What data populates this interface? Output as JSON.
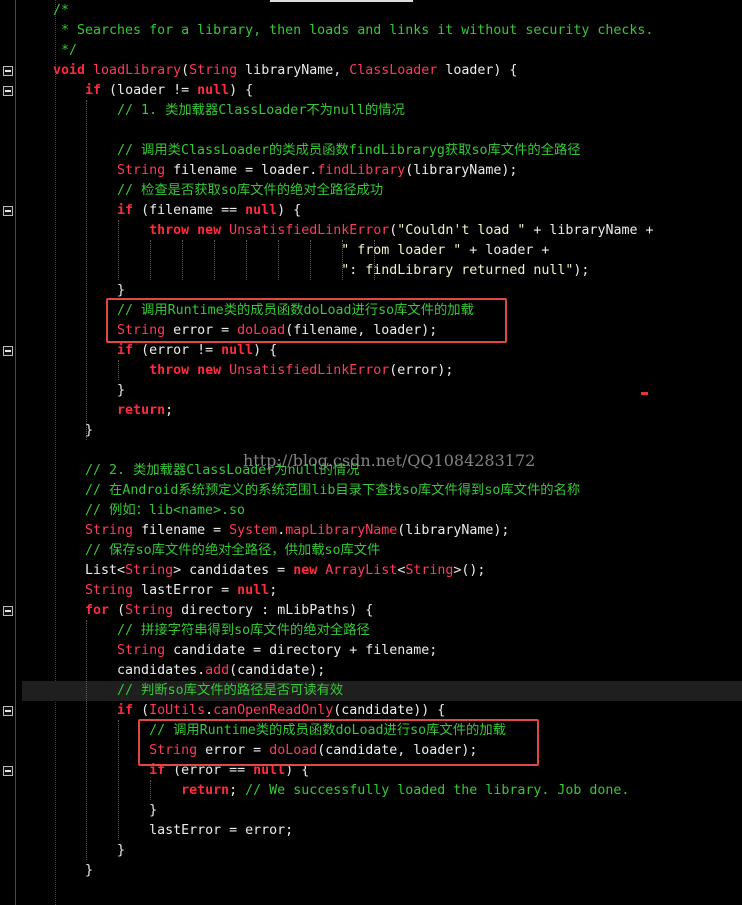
{
  "editor": {
    "lines": [
      [
        {
          "t": "/*",
          "c": "com"
        }
      ],
      [
        {
          "t": " * Searches for a library, then loads and links it without security checks.",
          "c": "com"
        }
      ],
      [
        {
          "t": " */",
          "c": "com"
        }
      ],
      [
        {
          "t": "void",
          "c": "kw"
        },
        {
          "t": " ",
          "c": "plain"
        },
        {
          "t": "loadLibrary",
          "c": "fn"
        },
        {
          "t": "(",
          "c": "plain"
        },
        {
          "t": "String",
          "c": "ty"
        },
        {
          "t": " libraryName, ",
          "c": "plain"
        },
        {
          "t": "ClassLoader",
          "c": "ty"
        },
        {
          "t": " loader) {",
          "c": "plain"
        }
      ],
      [
        {
          "t": "    ",
          "c": "plain"
        },
        {
          "t": "if",
          "c": "kw"
        },
        {
          "t": " (loader != ",
          "c": "plain"
        },
        {
          "t": "null",
          "c": "kw"
        },
        {
          "t": ") {",
          "c": "plain"
        }
      ],
      [
        {
          "t": "        // 1. 类加载器ClassLoader不为null的情况",
          "c": "com"
        }
      ],
      [],
      [
        {
          "t": "        // 调用类ClassLoader的类成员函数findLibraryg获取so库文件的全路径",
          "c": "com"
        }
      ],
      [
        {
          "t": "        ",
          "c": "plain"
        },
        {
          "t": "String",
          "c": "ty"
        },
        {
          "t": " filename = loader.",
          "c": "plain"
        },
        {
          "t": "findLibrary",
          "c": "fn"
        },
        {
          "t": "(libraryName);",
          "c": "plain"
        }
      ],
      [
        {
          "t": "        // 检查是否获取so库文件的绝对全路径成功",
          "c": "com"
        }
      ],
      [
        {
          "t": "        ",
          "c": "plain"
        },
        {
          "t": "if",
          "c": "kw"
        },
        {
          "t": " (filename == ",
          "c": "plain"
        },
        {
          "t": "null",
          "c": "kw"
        },
        {
          "t": ") {",
          "c": "plain"
        }
      ],
      [
        {
          "t": "            ",
          "c": "plain"
        },
        {
          "t": "throw",
          "c": "kw"
        },
        {
          "t": " ",
          "c": "plain"
        },
        {
          "t": "new",
          "c": "kw"
        },
        {
          "t": " ",
          "c": "plain"
        },
        {
          "t": "UnsatisfiedLinkError",
          "c": "ty"
        },
        {
          "t": "(",
          "c": "plain"
        },
        {
          "t": "\"Couldn't load \"",
          "c": "str"
        },
        {
          "t": " + libraryName +",
          "c": "plain"
        }
      ],
      [
        {
          "t": "                                    ",
          "c": "plain"
        },
        {
          "t": "\" from loader \"",
          "c": "str"
        },
        {
          "t": " + loader +",
          "c": "plain"
        }
      ],
      [
        {
          "t": "                                    ",
          "c": "plain"
        },
        {
          "t": "\": findLibrary returned null\"",
          "c": "str"
        },
        {
          "t": ");",
          "c": "plain"
        }
      ],
      [
        {
          "t": "        }",
          "c": "plain"
        }
      ],
      [
        {
          "t": "        // 调用Runtime类的成员函数doLoad进行so库文件的加载",
          "c": "com"
        }
      ],
      [
        {
          "t": "        ",
          "c": "plain"
        },
        {
          "t": "String",
          "c": "ty"
        },
        {
          "t": " error = ",
          "c": "plain"
        },
        {
          "t": "doLoad",
          "c": "fn"
        },
        {
          "t": "(filename, loader);",
          "c": "plain"
        }
      ],
      [
        {
          "t": "        ",
          "c": "plain"
        },
        {
          "t": "if",
          "c": "kw"
        },
        {
          "t": " (error != ",
          "c": "plain"
        },
        {
          "t": "null",
          "c": "kw"
        },
        {
          "t": ") {",
          "c": "plain"
        }
      ],
      [
        {
          "t": "            ",
          "c": "plain"
        },
        {
          "t": "throw",
          "c": "kw"
        },
        {
          "t": " ",
          "c": "plain"
        },
        {
          "t": "new",
          "c": "kw"
        },
        {
          "t": " ",
          "c": "plain"
        },
        {
          "t": "UnsatisfiedLinkError",
          "c": "ty"
        },
        {
          "t": "(error);",
          "c": "plain"
        }
      ],
      [
        {
          "t": "        }",
          "c": "plain"
        }
      ],
      [
        {
          "t": "        ",
          "c": "plain"
        },
        {
          "t": "return",
          "c": "kw"
        },
        {
          "t": ";",
          "c": "plain"
        }
      ],
      [
        {
          "t": "    }",
          "c": "plain"
        }
      ],
      [],
      [
        {
          "t": "    // 2. 类加载器ClassLoader为null的情况",
          "c": "com"
        }
      ],
      [
        {
          "t": "    // 在Android系统预定义的系统范围lib目录下查找so库文件得到so库文件的名称",
          "c": "com"
        }
      ],
      [
        {
          "t": "    // 例如：lib<name>.so",
          "c": "com"
        }
      ],
      [
        {
          "t": "    ",
          "c": "plain"
        },
        {
          "t": "String",
          "c": "ty"
        },
        {
          "t": " filename = ",
          "c": "plain"
        },
        {
          "t": "System",
          "c": "ty"
        },
        {
          "t": ".",
          "c": "plain"
        },
        {
          "t": "mapLibraryName",
          "c": "fn"
        },
        {
          "t": "(libraryName);",
          "c": "plain"
        }
      ],
      [
        {
          "t": "    // 保存so库文件的绝对全路径，供加载so库文件",
          "c": "com"
        }
      ],
      [
        {
          "t": "    List<",
          "c": "plain"
        },
        {
          "t": "String",
          "c": "ty"
        },
        {
          "t": "> candidates = ",
          "c": "plain"
        },
        {
          "t": "new",
          "c": "kw"
        },
        {
          "t": " ",
          "c": "plain"
        },
        {
          "t": "ArrayList",
          "c": "ty"
        },
        {
          "t": "<",
          "c": "plain"
        },
        {
          "t": "String",
          "c": "ty"
        },
        {
          "t": ">();",
          "c": "plain"
        }
      ],
      [
        {
          "t": "    ",
          "c": "plain"
        },
        {
          "t": "String",
          "c": "ty"
        },
        {
          "t": " lastError = ",
          "c": "plain"
        },
        {
          "t": "null",
          "c": "kw"
        },
        {
          "t": ";",
          "c": "plain"
        }
      ],
      [
        {
          "t": "    ",
          "c": "plain"
        },
        {
          "t": "for",
          "c": "kw"
        },
        {
          "t": " (",
          "c": "plain"
        },
        {
          "t": "String",
          "c": "ty"
        },
        {
          "t": " directory : mLibPaths) {",
          "c": "plain"
        }
      ],
      [
        {
          "t": "        // 拼接字符串得到so库文件的绝对全路径",
          "c": "com"
        }
      ],
      [
        {
          "t": "        ",
          "c": "plain"
        },
        {
          "t": "String",
          "c": "ty"
        },
        {
          "t": " candidate = directory + filename;",
          "c": "plain"
        }
      ],
      [
        {
          "t": "        candidates.",
          "c": "plain"
        },
        {
          "t": "add",
          "c": "fn"
        },
        {
          "t": "(candidate);",
          "c": "plain"
        }
      ],
      [
        {
          "t": "        // 判断so库文件的路径是否可读有效",
          "c": "com"
        }
      ],
      [
        {
          "t": "        ",
          "c": "plain"
        },
        {
          "t": "if",
          "c": "kw"
        },
        {
          "t": " (",
          "c": "plain"
        },
        {
          "t": "IoUtils",
          "c": "ty"
        },
        {
          "t": ".",
          "c": "plain"
        },
        {
          "t": "canOpenReadOnly",
          "c": "fn"
        },
        {
          "t": "(candidate)) {",
          "c": "plain"
        }
      ],
      [
        {
          "t": "            // 调用Runtime类的成员函数doLoad进行so库文件的加载",
          "c": "com"
        }
      ],
      [
        {
          "t": "            ",
          "c": "plain"
        },
        {
          "t": "String",
          "c": "ty"
        },
        {
          "t": " error = ",
          "c": "plain"
        },
        {
          "t": "doLoad",
          "c": "fn"
        },
        {
          "t": "(candidate, loader);",
          "c": "plain"
        }
      ],
      [
        {
          "t": "            ",
          "c": "plain"
        },
        {
          "t": "if",
          "c": "kw"
        },
        {
          "t": " (error == ",
          "c": "plain"
        },
        {
          "t": "null",
          "c": "kw"
        },
        {
          "t": ") {",
          "c": "plain"
        }
      ],
      [
        {
          "t": "                ",
          "c": "plain"
        },
        {
          "t": "return",
          "c": "kw"
        },
        {
          "t": "; ",
          "c": "plain"
        },
        {
          "t": "// We successfully loaded the library. Job done.",
          "c": "com"
        }
      ],
      [
        {
          "t": "            }",
          "c": "plain"
        }
      ],
      [
        {
          "t": "            lastError = error;",
          "c": "plain"
        }
      ],
      [
        {
          "t": "        }",
          "c": "plain"
        }
      ],
      [
        {
          "t": "    }",
          "c": "plain"
        }
      ]
    ],
    "watermark": "http://blog.csdn.net/QQ1084283172"
  },
  "colors": {
    "background": "#000000",
    "keyword": "#ff2a3b",
    "type": "#ff3b5a",
    "comment": "#37c837",
    "string": "#f1f1c8",
    "text": "#ececec",
    "highlight_box": "#e04848"
  }
}
